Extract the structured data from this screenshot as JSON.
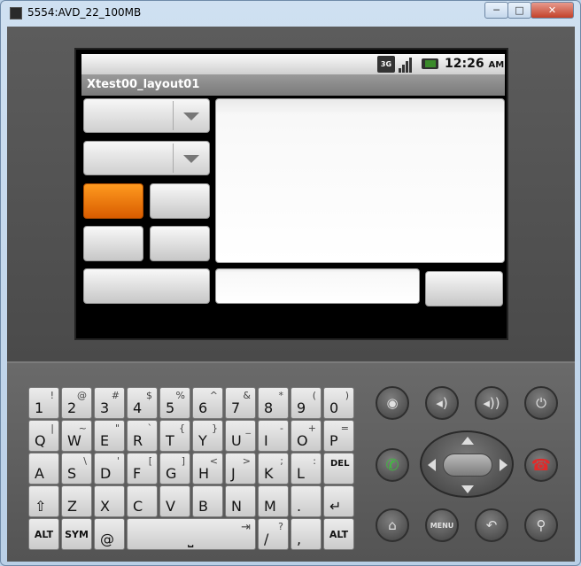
{
  "window": {
    "title": "5554:AVD_22_100MB",
    "min": "─",
    "max": "□",
    "close": "✕"
  },
  "statusbar": {
    "network": "3G",
    "time": "12:26",
    "ampm": "AM"
  },
  "app": {
    "title": "Xtest00_layout01"
  },
  "keyboard": {
    "row1": [
      {
        "m": "1",
        "a": "!"
      },
      {
        "m": "2",
        "a": "@"
      },
      {
        "m": "3",
        "a": "#"
      },
      {
        "m": "4",
        "a": "$"
      },
      {
        "m": "5",
        "a": "%"
      },
      {
        "m": "6",
        "a": "^"
      },
      {
        "m": "7",
        "a": "&"
      },
      {
        "m": "8",
        "a": "*"
      },
      {
        "m": "9",
        "a": "("
      },
      {
        "m": "0",
        "a": ")"
      }
    ],
    "row2": [
      {
        "m": "Q",
        "a": "|"
      },
      {
        "m": "W",
        "a": "~"
      },
      {
        "m": "E",
        "a": "\""
      },
      {
        "m": "R",
        "a": "`"
      },
      {
        "m": "T",
        "a": "{"
      },
      {
        "m": "Y",
        "a": "}"
      },
      {
        "m": "U",
        "a": "_"
      },
      {
        "m": "I",
        "a": "-"
      },
      {
        "m": "O",
        "a": "+"
      },
      {
        "m": "P",
        "a": "="
      }
    ],
    "row3": [
      {
        "m": "A",
        "a": ""
      },
      {
        "m": "S",
        "a": "\\"
      },
      {
        "m": "D",
        "a": "'"
      },
      {
        "m": "F",
        "a": "["
      },
      {
        "m": "G",
        "a": "]"
      },
      {
        "m": "H",
        "a": "<"
      },
      {
        "m": "J",
        "a": ">"
      },
      {
        "m": "K",
        "a": ";"
      },
      {
        "m": "L",
        "a": ":"
      },
      {
        "m": "DEL",
        "a": ""
      }
    ],
    "row4": [
      {
        "m": "⇧",
        "a": ""
      },
      {
        "m": "Z",
        "a": ""
      },
      {
        "m": "X",
        "a": ""
      },
      {
        "m": "C",
        "a": ""
      },
      {
        "m": "V",
        "a": ""
      },
      {
        "m": "B",
        "a": ""
      },
      {
        "m": "N",
        "a": ""
      },
      {
        "m": "M",
        "a": ""
      },
      {
        "m": ".",
        "a": ""
      },
      {
        "m": "↵",
        "a": ""
      }
    ],
    "row5": {
      "alt_left": "ALT",
      "sym": "SYM",
      "at": "@",
      "space": "⎵",
      "tab": "⇥",
      "slash": "/",
      "question": "?",
      "comma": ",",
      "alt_right": "ALT"
    }
  },
  "controls": {
    "menu": "MENU"
  }
}
